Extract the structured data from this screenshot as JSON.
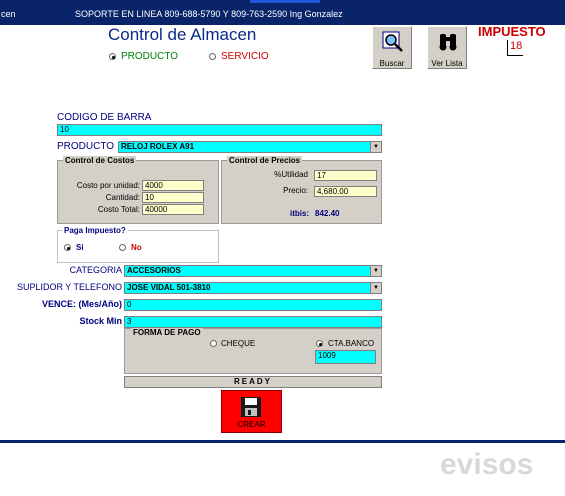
{
  "titlebar": {
    "app_fragment": "cen",
    "support_text": "SOPORTE EN LINEA 809-688-5790 Y 809-763-2590  Ing Gonzalez"
  },
  "header": {
    "title": "Control de Almacen",
    "radio_producto": "PRODUCTO",
    "radio_servicio": "SERVICIO"
  },
  "toolbar": {
    "buscar_label": "Buscar",
    "verlista_label": "Ver Lista"
  },
  "impuesto": {
    "label": "IMPUESTO",
    "value": "18"
  },
  "codigo": {
    "label": "CODIGO DE BARRA",
    "value": "10"
  },
  "producto": {
    "label": "PRODUCTO",
    "value": "RELOJ ROLEX A91"
  },
  "costos": {
    "title": "Control de Costos",
    "costo_unidad_label": "Costo por unidad:",
    "costo_unidad_value": "4000",
    "cantidad_label": "Cantidad:",
    "cantidad_value": "10",
    "costo_total_label": "Costo Total:",
    "costo_total_value": "40000"
  },
  "precios": {
    "title": "Control de Precios",
    "utilidad_label": "%Utilidad",
    "utilidad_value": "17",
    "precio_label": "Precio:",
    "precio_value": "4,680.00",
    "itbis_label": "itbis:",
    "itbis_value": "842.40"
  },
  "paga_impuesto": {
    "title": "Paga Impuesto?",
    "si": "Si",
    "no": "No"
  },
  "categoria": {
    "label": "CATEGORIA",
    "value": "ACCESORIOS"
  },
  "suplidor": {
    "label": "SUPLIDOR Y TELEFONO",
    "value": "JOSE VIDAL 501-3810"
  },
  "vence": {
    "label": "VENCE: (Mes/Año)",
    "value": "0"
  },
  "stock": {
    "label": "Stock Min",
    "value": "3"
  },
  "forma_pago": {
    "title": "FORMA DE PAGO",
    "cheque": "CHEQUE",
    "cta_banco": "CTA.BANCO",
    "cuenta_value": "1009"
  },
  "status": {
    "ready": "READY"
  },
  "actions": {
    "crear_label": "CREAR"
  },
  "watermark": {
    "text": "evisos"
  },
  "colors": {
    "field_cyan": "#00ffff",
    "field_yellow": "#ffffcc",
    "titlebar": "#0a246a",
    "title_blue": "#0a2a8a",
    "producto_green": "#008000",
    "servicio_red": "#cc0000",
    "crear_red": "#ff0000"
  }
}
